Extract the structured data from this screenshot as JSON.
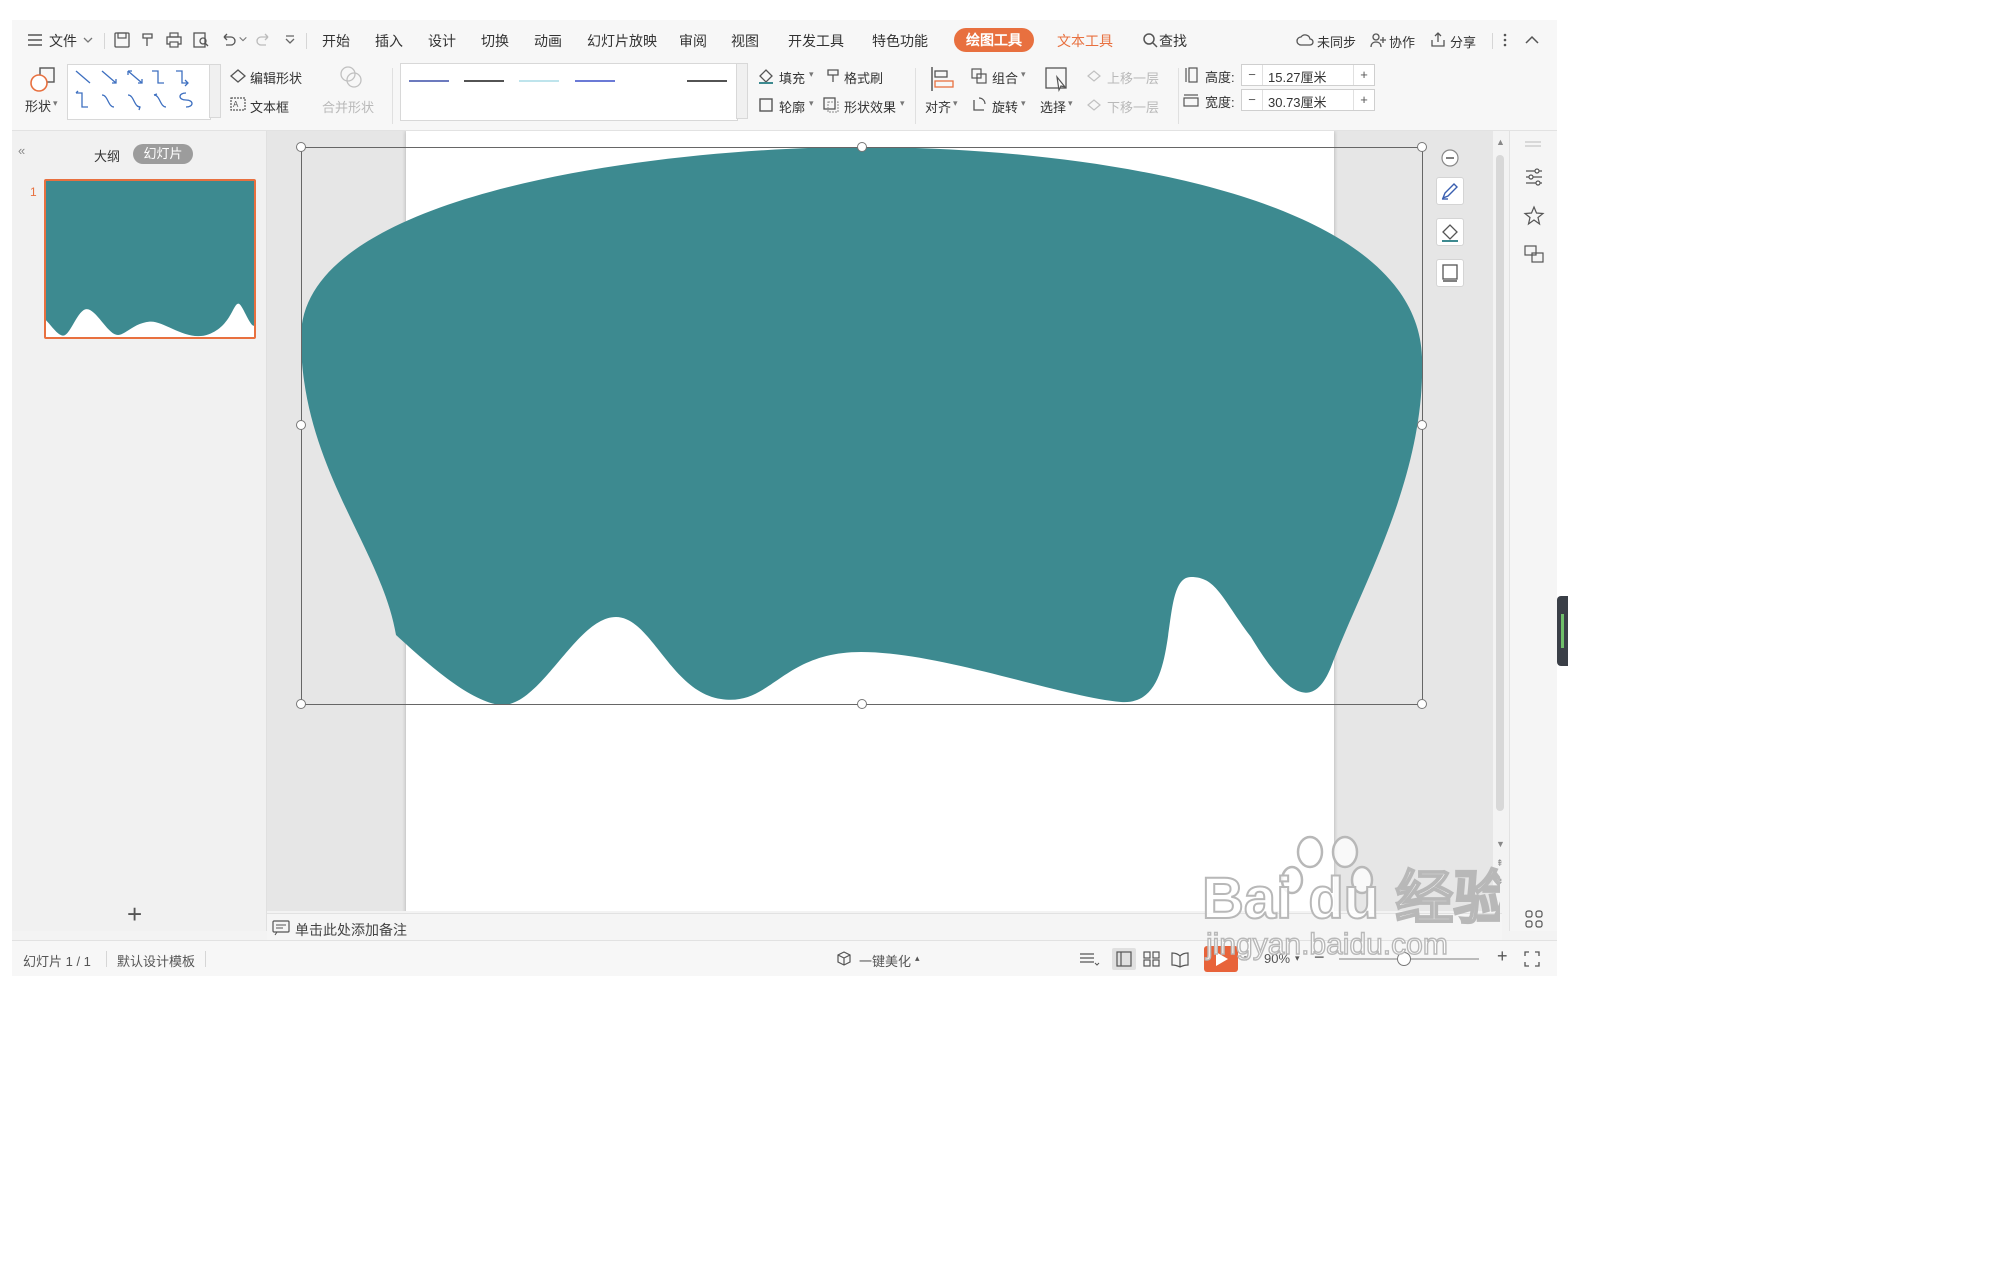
{
  "menu": {
    "file_label": "文件",
    "tabs": [
      "开始",
      "插入",
      "设计",
      "切换",
      "动画",
      "幻灯片放映",
      "审阅",
      "视图",
      "开发工具",
      "特色功能"
    ],
    "active_tab": "绘图工具",
    "context_tab": "文本工具",
    "search_label": "查找",
    "sync_label": "未同步",
    "collab_label": "协作",
    "share_label": "分享"
  },
  "ribbon": {
    "shape_label": "形状",
    "edit_shape_label": "编辑形状",
    "textbox_label": "文本框",
    "merge_shape_label": "合并形状",
    "fill_label": "填充",
    "format_painter_label": "格式刷",
    "outline_label": "轮廓",
    "shape_effect_label": "形状效果",
    "align_label": "对齐",
    "group_label": "组合",
    "rotate_label": "旋转",
    "select_label": "选择",
    "bring_forward_label": "上移一层",
    "send_backward_label": "下移一层",
    "height_label": "高度:",
    "height_value": "15.27厘米",
    "width_label": "宽度:",
    "width_value": "30.73厘米",
    "line_styles": [
      "#3b4fa8",
      "#1a1a1a",
      "#a8dbe6",
      "#3a4fc8",
      "#1a1a1a"
    ]
  },
  "left_panel": {
    "outline_tab": "大纲",
    "slides_tab": "幻灯片",
    "slide_number": "1",
    "add_slide": "+"
  },
  "shape": {
    "fill_color": "#3d8a90"
  },
  "notes": {
    "placeholder": "单击此处添加备注"
  },
  "status": {
    "slide_counter": "幻灯片 1 / 1",
    "template_name": "默认设计模板",
    "beautify_label": "一键美化",
    "zoom_level": "90%"
  },
  "watermark": {
    "brand": "Bai du 经验",
    "url": "jingyan.baidu.com"
  }
}
